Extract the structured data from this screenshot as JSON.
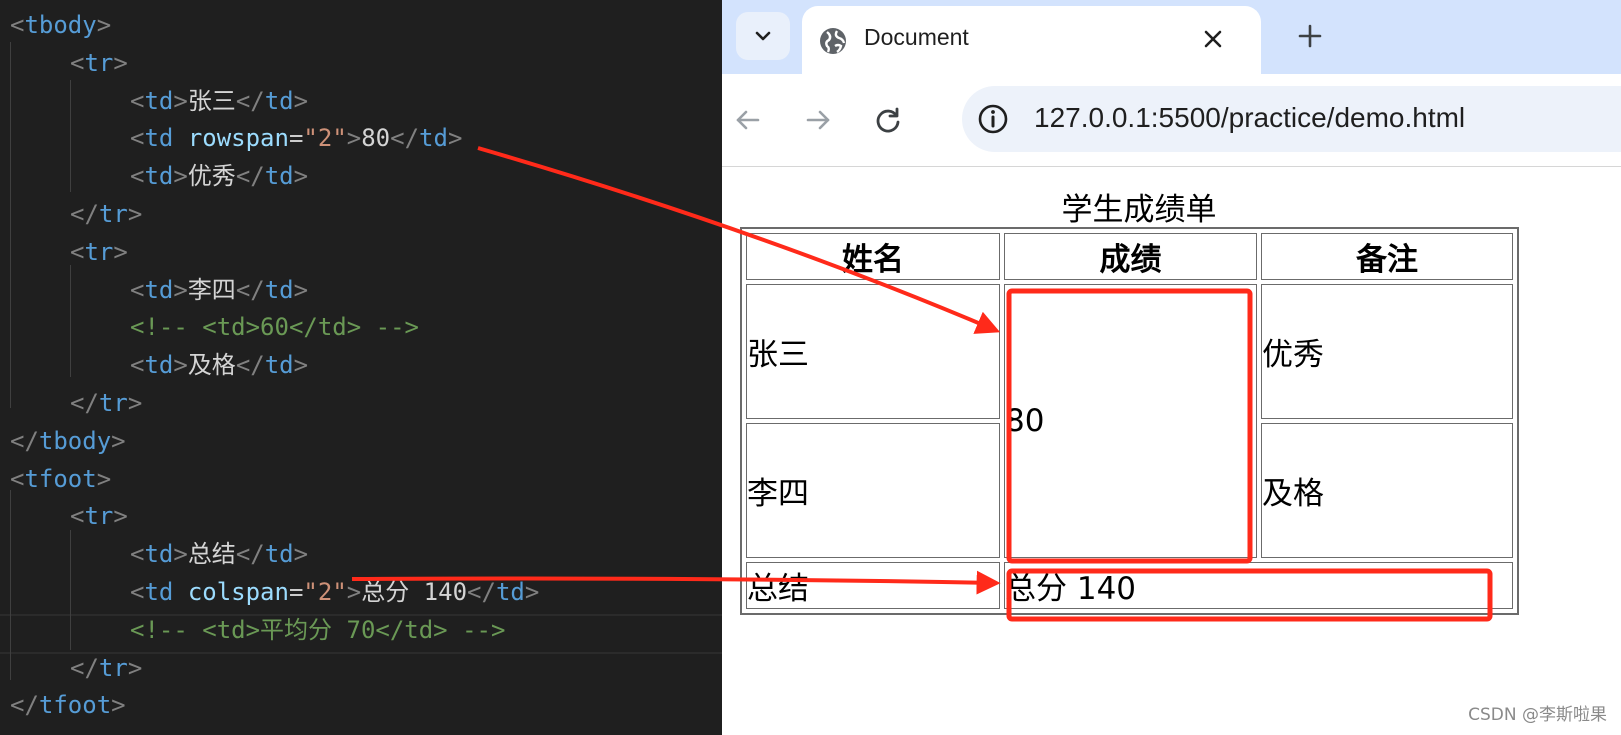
{
  "editor": {
    "lines": [
      [
        [
          "br",
          "<"
        ],
        [
          "tag",
          "tbody"
        ],
        [
          "br",
          ">"
        ]
      ],
      [
        [
          "br",
          "<"
        ],
        [
          "tag",
          "tr"
        ],
        [
          "br",
          ">"
        ]
      ],
      [
        [
          "br",
          "<"
        ],
        [
          "tag",
          "td"
        ],
        [
          "br",
          ">"
        ],
        [
          "txt",
          "张三"
        ],
        [
          "br",
          "</"
        ],
        [
          "tag",
          "td"
        ],
        [
          "br",
          ">"
        ]
      ],
      [
        [
          "br",
          "<"
        ],
        [
          "tag",
          "td"
        ],
        [
          "txt",
          " "
        ],
        [
          "attr",
          "rowspan"
        ],
        [
          "eq",
          "="
        ],
        [
          "str",
          "\"2\""
        ],
        [
          "br",
          ">"
        ],
        [
          "txt",
          "80"
        ],
        [
          "br",
          "</"
        ],
        [
          "tag",
          "td"
        ],
        [
          "br",
          ">"
        ]
      ],
      [
        [
          "br",
          "<"
        ],
        [
          "tag",
          "td"
        ],
        [
          "br",
          ">"
        ],
        [
          "txt",
          "优秀"
        ],
        [
          "br",
          "</"
        ],
        [
          "tag",
          "td"
        ],
        [
          "br",
          ">"
        ]
      ],
      [
        [
          "br",
          "</"
        ],
        [
          "tag",
          "tr"
        ],
        [
          "br",
          ">"
        ]
      ],
      [
        [
          "br",
          "<"
        ],
        [
          "tag",
          "tr"
        ],
        [
          "br",
          ">"
        ]
      ],
      [
        [
          "br",
          "<"
        ],
        [
          "tag",
          "td"
        ],
        [
          "br",
          ">"
        ],
        [
          "txt",
          "李四"
        ],
        [
          "br",
          "</"
        ],
        [
          "tag",
          "td"
        ],
        [
          "br",
          ">"
        ]
      ],
      [
        [
          "com",
          "<!-- <td>60</td> -->"
        ]
      ],
      [
        [
          "br",
          "<"
        ],
        [
          "tag",
          "td"
        ],
        [
          "br",
          ">"
        ],
        [
          "txt",
          "及格"
        ],
        [
          "br",
          "</"
        ],
        [
          "tag",
          "td"
        ],
        [
          "br",
          ">"
        ]
      ],
      [
        [
          "br",
          "</"
        ],
        [
          "tag",
          "tr"
        ],
        [
          "br",
          ">"
        ]
      ],
      [
        [
          "br",
          "</"
        ],
        [
          "tag",
          "tbody"
        ],
        [
          "br",
          ">"
        ]
      ],
      [
        [
          "br",
          "<"
        ],
        [
          "tag",
          "tfoot"
        ],
        [
          "br",
          ">"
        ]
      ],
      [
        [
          "br",
          "<"
        ],
        [
          "tag",
          "tr"
        ],
        [
          "br",
          ">"
        ]
      ],
      [
        [
          "br",
          "<"
        ],
        [
          "tag",
          "td"
        ],
        [
          "br",
          ">"
        ],
        [
          "txt",
          "总结"
        ],
        [
          "br",
          "</"
        ],
        [
          "tag",
          "td"
        ],
        [
          "br",
          ">"
        ]
      ],
      [
        [
          "br",
          "<"
        ],
        [
          "tag",
          "td"
        ],
        [
          "txt",
          " "
        ],
        [
          "attr",
          "colspan"
        ],
        [
          "eq",
          "="
        ],
        [
          "str",
          "\"2\""
        ],
        [
          "br",
          ">"
        ],
        [
          "txt",
          "总分 140"
        ],
        [
          "br",
          "</"
        ],
        [
          "tag",
          "td"
        ],
        [
          "br",
          ">"
        ]
      ],
      [
        [
          "com",
          "<!-- <td>平均分 70</td> -->"
        ]
      ],
      [
        [
          "br",
          "</"
        ],
        [
          "tag",
          "tr"
        ],
        [
          "br",
          ">"
        ]
      ],
      [
        [
          "br",
          "</"
        ],
        [
          "tag",
          "tfoot"
        ],
        [
          "br",
          ">"
        ]
      ]
    ]
  },
  "browser": {
    "tab_title": "Document",
    "url": "127.0.0.1:5500/practice/demo.html",
    "icons": {
      "tab_list": "chevron-down-icon",
      "favicon": "globe-icon",
      "close": "close-icon",
      "new_tab": "plus-icon",
      "back": "arrow-left-icon",
      "forward": "arrow-right-icon",
      "reload": "reload-icon",
      "site_info": "info-icon"
    }
  },
  "page": {
    "caption": "学生成绩单",
    "headers": [
      "姓名",
      "成绩",
      "备注"
    ],
    "rows": [
      {
        "name": "张三",
        "remark": "优秀"
      },
      {
        "name": "李四",
        "remark": "及格"
      }
    ],
    "shared_score": "80",
    "footer": {
      "label": "总结",
      "summary": "总分 140"
    }
  },
  "watermark": "CSDN @李斯啦果",
  "colors": {
    "annotation_red": "#ff2a1a",
    "editor_bg": "#1f1f1f",
    "tabstrip_bg": "#d3e3fd"
  }
}
